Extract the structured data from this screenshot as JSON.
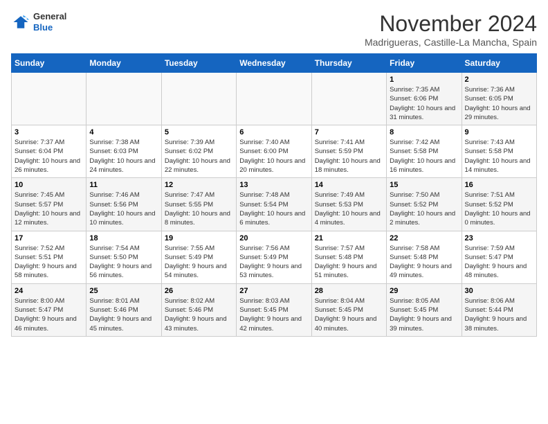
{
  "header": {
    "logo_line1": "General",
    "logo_line2": "Blue",
    "month": "November 2024",
    "location": "Madrigueras, Castille-La Mancha, Spain"
  },
  "days_of_week": [
    "Sunday",
    "Monday",
    "Tuesday",
    "Wednesday",
    "Thursday",
    "Friday",
    "Saturday"
  ],
  "weeks": [
    [
      {
        "day": "",
        "info": ""
      },
      {
        "day": "",
        "info": ""
      },
      {
        "day": "",
        "info": ""
      },
      {
        "day": "",
        "info": ""
      },
      {
        "day": "",
        "info": ""
      },
      {
        "day": "1",
        "info": "Sunrise: 7:35 AM\nSunset: 6:06 PM\nDaylight: 10 hours and 31 minutes."
      },
      {
        "day": "2",
        "info": "Sunrise: 7:36 AM\nSunset: 6:05 PM\nDaylight: 10 hours and 29 minutes."
      }
    ],
    [
      {
        "day": "3",
        "info": "Sunrise: 7:37 AM\nSunset: 6:04 PM\nDaylight: 10 hours and 26 minutes."
      },
      {
        "day": "4",
        "info": "Sunrise: 7:38 AM\nSunset: 6:03 PM\nDaylight: 10 hours and 24 minutes."
      },
      {
        "day": "5",
        "info": "Sunrise: 7:39 AM\nSunset: 6:02 PM\nDaylight: 10 hours and 22 minutes."
      },
      {
        "day": "6",
        "info": "Sunrise: 7:40 AM\nSunset: 6:00 PM\nDaylight: 10 hours and 20 minutes."
      },
      {
        "day": "7",
        "info": "Sunrise: 7:41 AM\nSunset: 5:59 PM\nDaylight: 10 hours and 18 minutes."
      },
      {
        "day": "8",
        "info": "Sunrise: 7:42 AM\nSunset: 5:58 PM\nDaylight: 10 hours and 16 minutes."
      },
      {
        "day": "9",
        "info": "Sunrise: 7:43 AM\nSunset: 5:58 PM\nDaylight: 10 hours and 14 minutes."
      }
    ],
    [
      {
        "day": "10",
        "info": "Sunrise: 7:45 AM\nSunset: 5:57 PM\nDaylight: 10 hours and 12 minutes."
      },
      {
        "day": "11",
        "info": "Sunrise: 7:46 AM\nSunset: 5:56 PM\nDaylight: 10 hours and 10 minutes."
      },
      {
        "day": "12",
        "info": "Sunrise: 7:47 AM\nSunset: 5:55 PM\nDaylight: 10 hours and 8 minutes."
      },
      {
        "day": "13",
        "info": "Sunrise: 7:48 AM\nSunset: 5:54 PM\nDaylight: 10 hours and 6 minutes."
      },
      {
        "day": "14",
        "info": "Sunrise: 7:49 AM\nSunset: 5:53 PM\nDaylight: 10 hours and 4 minutes."
      },
      {
        "day": "15",
        "info": "Sunrise: 7:50 AM\nSunset: 5:52 PM\nDaylight: 10 hours and 2 minutes."
      },
      {
        "day": "16",
        "info": "Sunrise: 7:51 AM\nSunset: 5:52 PM\nDaylight: 10 hours and 0 minutes."
      }
    ],
    [
      {
        "day": "17",
        "info": "Sunrise: 7:52 AM\nSunset: 5:51 PM\nDaylight: 9 hours and 58 minutes."
      },
      {
        "day": "18",
        "info": "Sunrise: 7:54 AM\nSunset: 5:50 PM\nDaylight: 9 hours and 56 minutes."
      },
      {
        "day": "19",
        "info": "Sunrise: 7:55 AM\nSunset: 5:49 PM\nDaylight: 9 hours and 54 minutes."
      },
      {
        "day": "20",
        "info": "Sunrise: 7:56 AM\nSunset: 5:49 PM\nDaylight: 9 hours and 53 minutes."
      },
      {
        "day": "21",
        "info": "Sunrise: 7:57 AM\nSunset: 5:48 PM\nDaylight: 9 hours and 51 minutes."
      },
      {
        "day": "22",
        "info": "Sunrise: 7:58 AM\nSunset: 5:48 PM\nDaylight: 9 hours and 49 minutes."
      },
      {
        "day": "23",
        "info": "Sunrise: 7:59 AM\nSunset: 5:47 PM\nDaylight: 9 hours and 48 minutes."
      }
    ],
    [
      {
        "day": "24",
        "info": "Sunrise: 8:00 AM\nSunset: 5:47 PM\nDaylight: 9 hours and 46 minutes."
      },
      {
        "day": "25",
        "info": "Sunrise: 8:01 AM\nSunset: 5:46 PM\nDaylight: 9 hours and 45 minutes."
      },
      {
        "day": "26",
        "info": "Sunrise: 8:02 AM\nSunset: 5:46 PM\nDaylight: 9 hours and 43 minutes."
      },
      {
        "day": "27",
        "info": "Sunrise: 8:03 AM\nSunset: 5:45 PM\nDaylight: 9 hours and 42 minutes."
      },
      {
        "day": "28",
        "info": "Sunrise: 8:04 AM\nSunset: 5:45 PM\nDaylight: 9 hours and 40 minutes."
      },
      {
        "day": "29",
        "info": "Sunrise: 8:05 AM\nSunset: 5:45 PM\nDaylight: 9 hours and 39 minutes."
      },
      {
        "day": "30",
        "info": "Sunrise: 8:06 AM\nSunset: 5:44 PM\nDaylight: 9 hours and 38 minutes."
      }
    ]
  ]
}
